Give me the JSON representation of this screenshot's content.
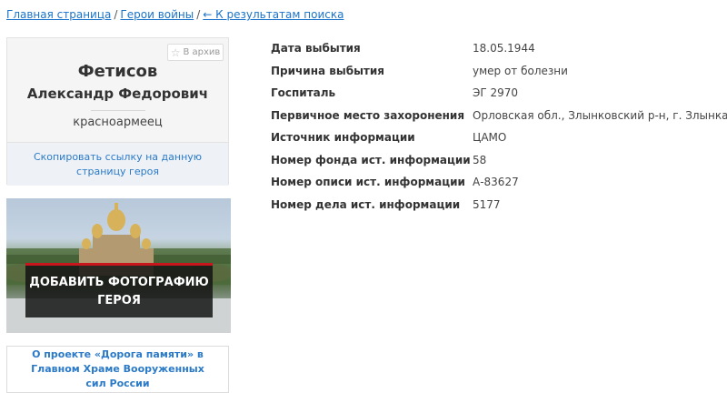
{
  "breadcrumb": {
    "home": "Главная страница",
    "heroes": "Герои войны",
    "back": "← К результатам поиска",
    "sep": "/"
  },
  "card": {
    "archive_label": "В архив",
    "surname": "Фетисов",
    "given_names": "Александр Федорович",
    "rank": "красноармеец",
    "copy_link": "Скопировать ссылку на данную страницу героя"
  },
  "banner": {
    "add_photo": "ДОБАВИТЬ ФОТОГРАФИЮ ГЕРОЯ"
  },
  "about": {
    "text": "О проекте «Дорога памяти» в Главном Храме Вооруженных сил России"
  },
  "details": [
    {
      "label": "Дата выбытия",
      "value": "18.05.1944"
    },
    {
      "label": "Причина выбытия",
      "value": "умер от болезни"
    },
    {
      "label": "Госпиталь",
      "value": "ЭГ 2970"
    },
    {
      "label": "Первичное место захоронения",
      "value": "Орловская обл., Злынковский р-н, г. Злынка"
    },
    {
      "label": "Источник информации",
      "value": "ЦАМО"
    },
    {
      "label": "Номер фонда ист. информации",
      "value": "58"
    },
    {
      "label": "Номер описи ист. информации",
      "value": "А-83627"
    },
    {
      "label": "Номер дела ист. информации",
      "value": "5177"
    }
  ],
  "colors": {
    "link": "#1a73c8",
    "accent": "#c8161d"
  }
}
